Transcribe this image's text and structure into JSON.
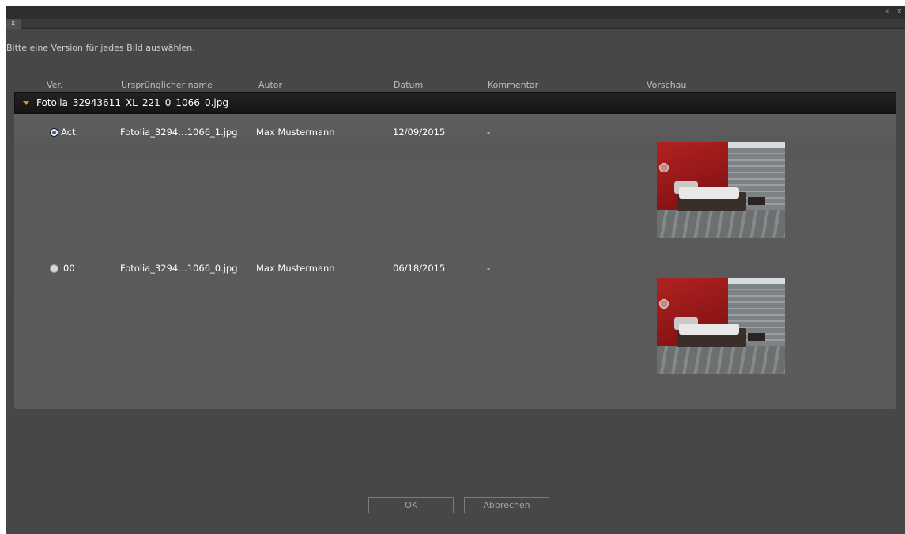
{
  "window": {
    "collapse_icon": "«",
    "close_icon": "×"
  },
  "menu": {
    "icon": "⇕"
  },
  "instruction": "Bitte eine Version für jedes Bild auswählen.",
  "columns": {
    "ver": "Ver.",
    "name": "Ursprünglicher name",
    "author": "Autor",
    "date": "Datum",
    "comment": "Kommentar",
    "preview": "Vorschau"
  },
  "group": {
    "title": "Fotolia_32943611_XL_221_0_1066_0.jpg"
  },
  "rows": [
    {
      "version": "Act.",
      "selected": true,
      "name": "Fotolia_3294…1066_1.jpg",
      "author": "Max Mustermann",
      "date": "12/09/2015",
      "comment": "-"
    },
    {
      "version": "00",
      "selected": false,
      "name": "Fotolia_3294…1066_0.jpg",
      "author": "Max Mustermann",
      "date": "06/18/2015",
      "comment": "-"
    }
  ],
  "buttons": {
    "ok": "OK",
    "cancel": "Abbrechen"
  },
  "colors": {
    "accent_arrow": "#e08a1e",
    "radio_selected": "#1a63c6",
    "panel_bg": "#474747"
  }
}
